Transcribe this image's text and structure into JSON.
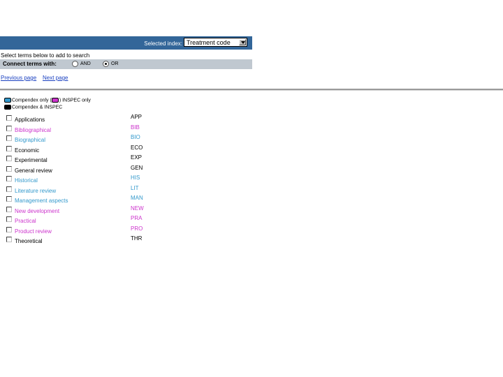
{
  "header": {
    "selected_index_label": "Selected index:",
    "selected_index_value": "Treatment code"
  },
  "instructions": "Select terms below to add to search",
  "connect": {
    "label": "Connect terms with:",
    "options": [
      {
        "label": "AND",
        "selected": false
      },
      {
        "label": "OR",
        "selected": true
      }
    ]
  },
  "pagination": {
    "previous": "Previous page",
    "next": "Next page"
  },
  "legend": {
    "compendex_only": "Compendex only (",
    "inspec_only": ") INSPEC only",
    "both": "Compendex & INSPEC"
  },
  "colors": {
    "compendex": "#3399cc",
    "inspec": "#cc33cc",
    "both": "#000000",
    "header_bg": "#336699"
  },
  "terms": [
    {
      "label": "Applications",
      "code": "APP",
      "color": "#000000"
    },
    {
      "label": "Bibliographical",
      "code": "BIB",
      "color": "#cc33cc"
    },
    {
      "label": "Biographical",
      "code": "BIO",
      "color": "#3399cc"
    },
    {
      "label": "Economic",
      "code": "ECO",
      "color": "#000000"
    },
    {
      "label": "Experimental",
      "code": "EXP",
      "color": "#000000"
    },
    {
      "label": "General review",
      "code": "GEN",
      "color": "#000000"
    },
    {
      "label": "Historical",
      "code": "HIS",
      "color": "#3399cc"
    },
    {
      "label": "Literature review",
      "code": "LIT",
      "color": "#3399cc"
    },
    {
      "label": "Management aspects",
      "code": "MAN",
      "color": "#3399cc"
    },
    {
      "label": "New development",
      "code": "NEW",
      "color": "#cc33cc"
    },
    {
      "label": "Practical",
      "code": "PRA",
      "color": "#cc33cc"
    },
    {
      "label": "Product review",
      "code": "PRO",
      "color": "#cc33cc"
    },
    {
      "label": "Theoretical",
      "code": "THR",
      "color": "#000000"
    }
  ]
}
